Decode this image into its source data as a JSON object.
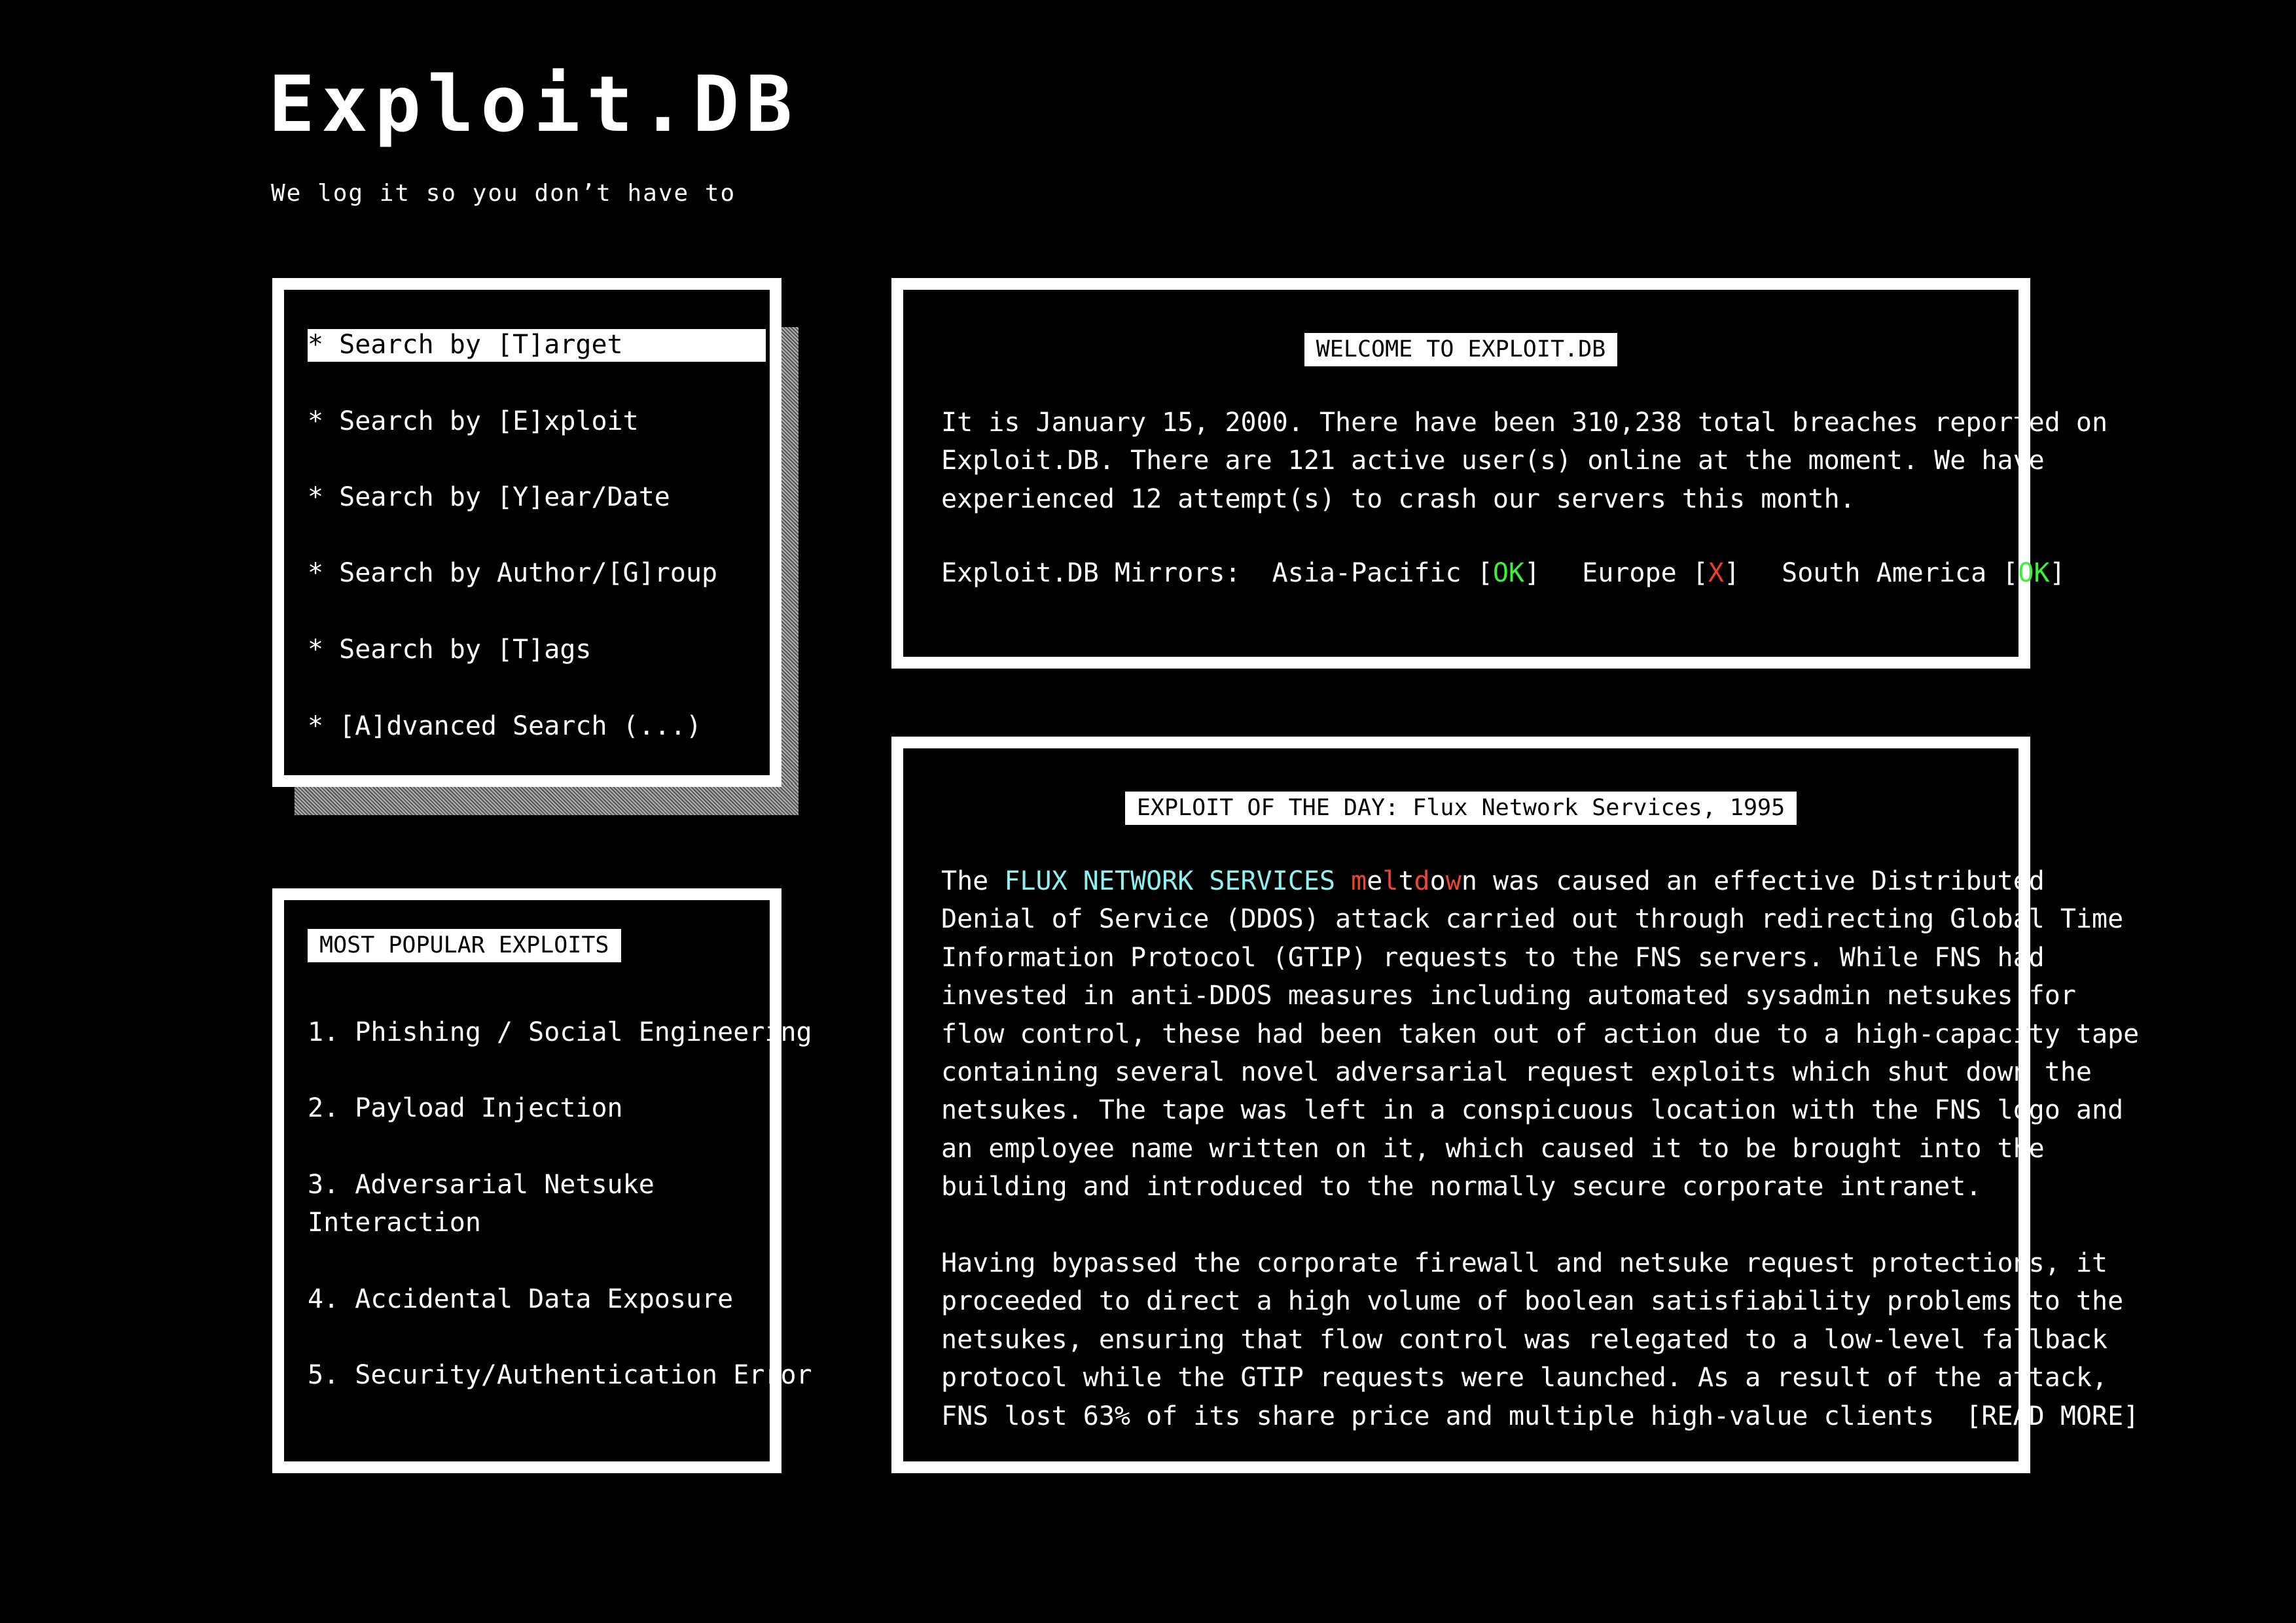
{
  "brand": {
    "title": "Exploit.DB",
    "tagline": "We log it so you don’t have to"
  },
  "search_menu": {
    "items": [
      {
        "label": "* Search by [T]arget",
        "selected": true
      },
      {
        "label": "* Search by [E]xploit",
        "selected": false
      },
      {
        "label": "* Search by [Y]ear/Date",
        "selected": false
      },
      {
        "label": "* Search by Author/[G]roup",
        "selected": false
      },
      {
        "label": "* Search by [T]ags",
        "selected": false
      },
      {
        "label": "* [A]dvanced Search (...)",
        "selected": false
      }
    ]
  },
  "popular": {
    "heading": "MOST POPULAR EXPLOITS",
    "items": [
      {
        "line1": "1. Phishing / Social Engineering",
        "line2": ""
      },
      {
        "line1": "2. Payload Injection",
        "line2": ""
      },
      {
        "line1": "3. Adversarial Netsuke",
        "line2": "Interaction"
      },
      {
        "line1": "4. Accidental Data Exposure",
        "line2": ""
      },
      {
        "line1": "5. Security/Authentication Error",
        "line2": ""
      }
    ]
  },
  "welcome": {
    "heading": "WELCOME TO EXPLOIT.DB",
    "lines": [
      "It is January 15, 2000. There have been 310,238 total breaches reported on",
      "Exploit.DB. There are 121 active user(s) online at the moment. We have",
      "experienced 12 attempt(s) to crash our servers this month."
    ],
    "mirrors": {
      "label": "Exploit.DB Mirrors:",
      "regions": [
        {
          "name": "Asia-Pacific",
          "status": "OK",
          "color": "#3cf03c"
        },
        {
          "name": "Europe",
          "status": "X",
          "color": "#f03c28"
        },
        {
          "name": "South America",
          "status": "OK",
          "color": "#3cf03c"
        }
      ]
    }
  },
  "exploit_of_day": {
    "heading": "EXPLOIT OF THE DAY: Flux Network Services, 1995",
    "intro": {
      "prefix": "The ",
      "highlight": "FLUX NETWORK SERVICES",
      "meltdown_letters": [
        "m",
        "e",
        "l",
        "t",
        "d",
        "o",
        "w",
        "n"
      ],
      "meltdown_colors": [
        "#ee4530",
        "#ffffff",
        "#ee4530",
        "#ffffff",
        "#ee4530",
        "#ffffff",
        "#ee4530",
        "#ffffff"
      ],
      "suffix": " was caused an effective Distributed"
    },
    "paragraph1": [
      "Denial of Service (DDOS) attack carried out through redirecting Global Time",
      "Information Protocol (GTIP) requests to the FNS servers. While FNS had",
      "invested in anti-DDOS measures including automated sysadmin netsukes for",
      "flow control, these had been taken out of action due to a high-capacity tape",
      "containing several novel adversarial request exploits which shut down the",
      "netsukes. The tape was left in a conspicuous location with the FNS logo and",
      "an employee name written on it, which caused it to be brought into the",
      "building and introduced to the normally secure corporate intranet."
    ],
    "paragraph2": [
      "Having bypassed the corporate firewall and netsuke request protections, it",
      "proceeded to direct a high volume of boolean satisfiability problems to the",
      "netsukes, ensuring that flow control was relegated to a low-level fallback",
      "protocol while the GTIP requests were launched. As a result of the attack,"
    ],
    "last_line": "FNS lost 63% of its share price and multiple high-value clients",
    "read_more": "[READ MORE]"
  },
  "colors": {
    "background": "#000000",
    "foreground": "#ffffff",
    "ok": "#3cf03c",
    "error": "#f03c28",
    "highlight_cyan": "#8ff0f0"
  }
}
